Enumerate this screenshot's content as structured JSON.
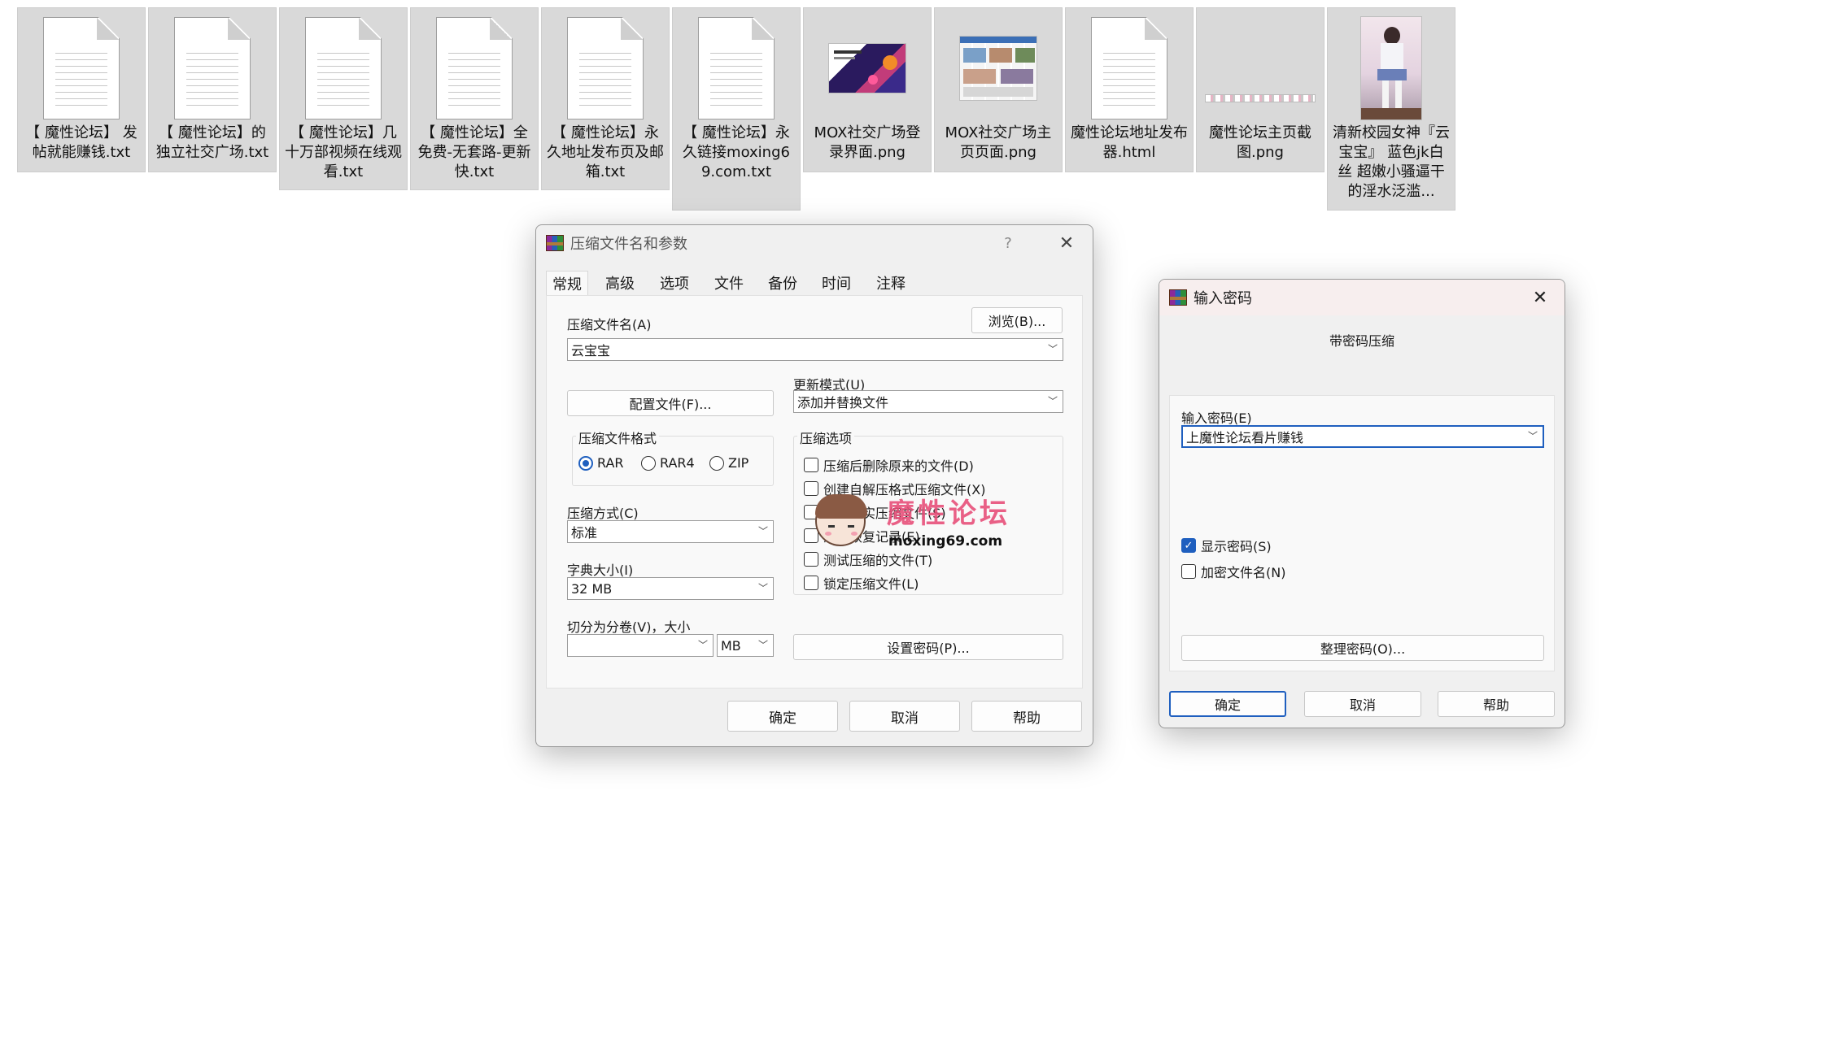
{
  "desktop": {
    "files": [
      {
        "name": "【 魔性论坛】 发帖就能赚钱.txt",
        "kind": "txt"
      },
      {
        "name": "【 魔性论坛】的独立社交广场.txt",
        "kind": "txt"
      },
      {
        "name": "【 魔性论坛】几十万部视频在线观看.txt",
        "kind": "txt"
      },
      {
        "name": "【 魔性论坛】全免费-无套路-更新快.txt",
        "kind": "txt"
      },
      {
        "name": "【 魔性论坛】永久地址发布页及邮箱.txt",
        "kind": "txt"
      },
      {
        "name": "【 魔性论坛】永久链接moxing69.com.txt",
        "kind": "txt"
      },
      {
        "name": "MOX社交广场登录界面.png",
        "kind": "png-login"
      },
      {
        "name": "MOX社交广场主页页面.png",
        "kind": "png-home"
      },
      {
        "name": "魔性论坛地址发布器.html",
        "kind": "html"
      },
      {
        "name": "魔性论坛主页截图.png",
        "kind": "png-strip"
      },
      {
        "name": "清新校园女神『云宝宝』 蓝色jk白丝 超嫩小骚逼干的淫水泛滥...",
        "kind": "photo"
      }
    ]
  },
  "archive_dialog": {
    "title": "压缩文件名和参数",
    "help_glyph": "?",
    "close_glyph": "✕",
    "tabs": [
      "常规",
      "高级",
      "选项",
      "文件",
      "备份",
      "时间",
      "注释"
    ],
    "archive_name_label": "压缩文件名(A)",
    "browse_button": "浏览(B)...",
    "archive_name_value": "云宝宝",
    "update_mode_label": "更新模式(U)",
    "update_mode_value": "添加并替换文件",
    "profiles_button": "配置文件(F)...",
    "format_group_label": "压缩文件格式",
    "formats": [
      "RAR",
      "RAR4",
      "ZIP"
    ],
    "selected_format": "RAR",
    "method_label": "压缩方式(C)",
    "method_value": "标准",
    "dict_label": "字典大小(I)",
    "dict_value": "32 MB",
    "split_label": "切分为分卷(V)，大小",
    "split_value": "",
    "split_unit": "MB",
    "options_group_label": "压缩选项",
    "options": [
      {
        "label": "压缩后删除原来的文件(D)",
        "checked": false
      },
      {
        "label": "创建自解压格式压缩文件(X)",
        "checked": false
      },
      {
        "label": "创建固实压缩文件(S)",
        "checked": false
      },
      {
        "label": "添加恢复记录(E)",
        "checked": false
      },
      {
        "label": "测试压缩的文件(T)",
        "checked": false
      },
      {
        "label": "锁定压缩文件(L)",
        "checked": false
      }
    ],
    "set_password_button": "设置密码(P)...",
    "ok_button": "确定",
    "cancel_button": "取消",
    "help_button": "帮助"
  },
  "watermark": {
    "brand": "魔性论坛",
    "url": "moxing69.com"
  },
  "password_dialog": {
    "title": "输入密码",
    "close_glyph": "✕",
    "heading": "带密码压缩",
    "password_label": "输入密码(E)",
    "password_value": "上魔性论坛看片赚钱",
    "show_password_label": "显示密码(S)",
    "show_password_checked": true,
    "encrypt_names_label": "加密文件名(N)",
    "encrypt_names_checked": false,
    "organize_button": "整理密码(O)...",
    "ok_button": "确定",
    "cancel_button": "取消",
    "help_button": "帮助"
  },
  "colors": {
    "accent": "#1f5fbf",
    "dialog_bg": "#f0f0f0",
    "panel_bg": "#f9f9f9",
    "file_tile_bg": "#d9d9d9",
    "watermark_pink": "#e8507a"
  }
}
